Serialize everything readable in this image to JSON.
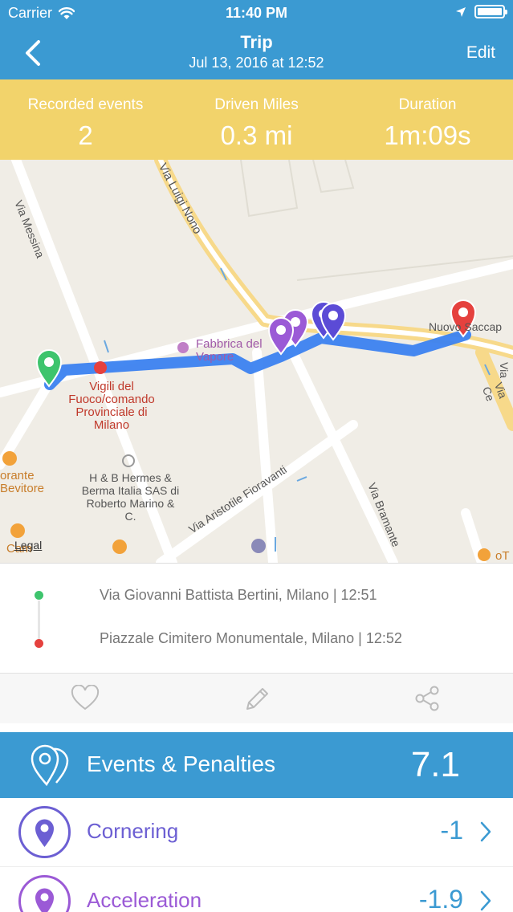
{
  "status_bar": {
    "carrier": "Carrier",
    "time": "11:40 PM"
  },
  "nav": {
    "title": "Trip",
    "subtitle": "Jul 13, 2016 at 12:52",
    "edit_label": "Edit"
  },
  "stats": [
    {
      "label": "Recorded events",
      "value": "2"
    },
    {
      "label": "Driven Miles",
      "value": "0.3 mi"
    },
    {
      "label": "Duration",
      "value": "1m:09s"
    }
  ],
  "map": {
    "streets": [
      "Via Messina",
      "Via Luigi Nono",
      "Via Aristotile Fioravanti",
      "Via Bramante",
      "Via Ce",
      "Via"
    ],
    "places": [
      "Fabbrica del Vapore",
      "Vigili del Fuoco/comando Provinciale di Milano",
      "H & B Hermes & Berma Italia SAS di Roberto Marino & C.",
      "Nuovo Saccap",
      "orante Bevitore",
      "Cam",
      "oT"
    ],
    "legal": "Legal"
  },
  "locations": {
    "start": "Via Giovanni Battista Bertini, Milano | 12:51",
    "end": "Piazzale Cimitero Monumentale, Milano | 12:52",
    "start_color": "#3ec46d",
    "end_color": "#e5413e"
  },
  "actions": {
    "icons": [
      "heart-icon",
      "pencil-icon",
      "share-icon"
    ]
  },
  "events": {
    "title": "Events & Penalties",
    "score": "7.1",
    "items": [
      {
        "name": "Cornering",
        "value": "-1"
      },
      {
        "name": "Acceleration",
        "value": "-1.9"
      }
    ]
  },
  "colors": {
    "primary": "#3b9ad2",
    "stats_bg": "#f2d36b",
    "event_purple": "#6c5fd3",
    "route": "#3b82f0"
  }
}
